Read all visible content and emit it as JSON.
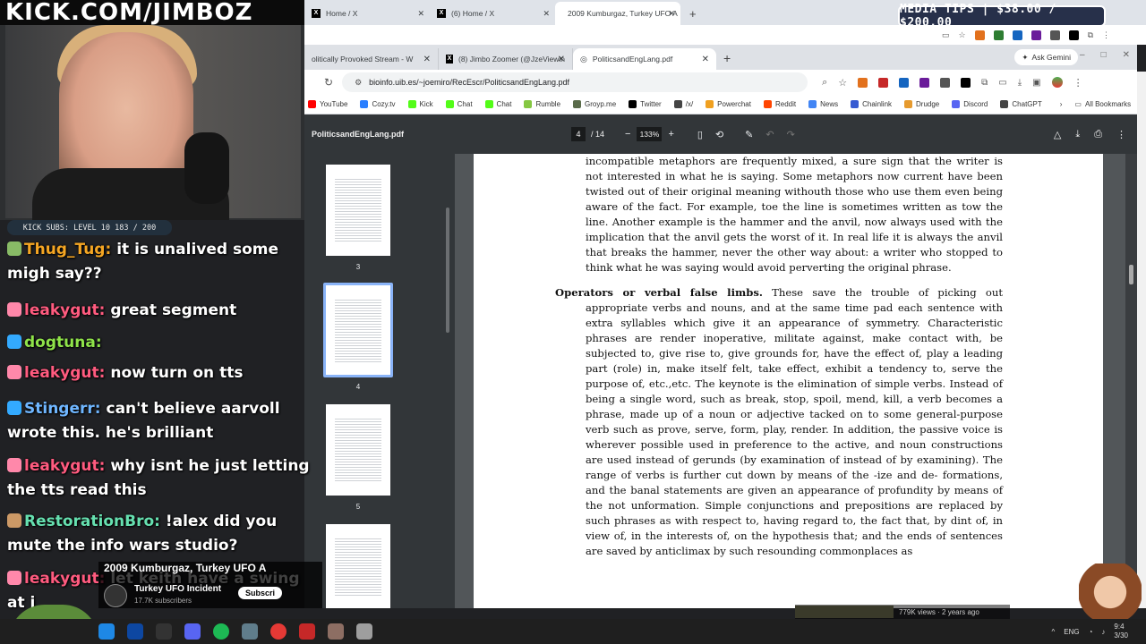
{
  "stream": {
    "banner": "KICK.COM/JIMBOZ",
    "subs_bar": "KICK SUBS: LEVEL 10 183 / 200",
    "media_tips": "MEDIA TIPS | $38.00 / $200.00"
  },
  "outer_browser": {
    "tabs": [
      {
        "label": "Home / X"
      },
      {
        "label": "(6) Home / X"
      },
      {
        "label": "2009 Kumburgaz, Turkey UFO A",
        "active": true
      }
    ]
  },
  "browser": {
    "tabs": [
      {
        "label": "olitically Provoked Stream - W"
      },
      {
        "label": "(8) Jimbo Zoomer (@JzeViewin"
      },
      {
        "label": "PoliticsandEngLang.pdf",
        "active": true
      }
    ],
    "gemini_label": "Ask Gemini",
    "url": "bioinfo.uib.es/~joemiro/RecEscr/PoliticsandEngLang.pdf",
    "bookmarks": [
      {
        "label": "YouTube",
        "color": "#ff0000"
      },
      {
        "label": "Cozy.tv",
        "color": "#2a7fff"
      },
      {
        "label": "Kick",
        "color": "#53fc18"
      },
      {
        "label": "Chat",
        "color": "#53fc18"
      },
      {
        "label": "Chat",
        "color": "#53fc18"
      },
      {
        "label": "Rumble",
        "color": "#85c742"
      },
      {
        "label": "Groyp.me",
        "color": "#5a6b4a"
      },
      {
        "label": "Twitter",
        "color": "#000000"
      },
      {
        "label": "/x/",
        "color": "#444444"
      },
      {
        "label": "Powerchat",
        "color": "#f0a020"
      },
      {
        "label": "Reddit",
        "color": "#ff4500"
      },
      {
        "label": "News",
        "color": "#4285f4"
      },
      {
        "label": "Chainlink",
        "color": "#375bd2"
      },
      {
        "label": "Drudge",
        "color": "#e69a2e"
      },
      {
        "label": "Discord",
        "color": "#5865f2"
      },
      {
        "label": "ChatGPT",
        "color": "#444444"
      }
    ],
    "all_bookmarks": "All Bookmarks"
  },
  "pdf": {
    "title": "PoliticsandEngLang.pdf",
    "page": "4",
    "page_total": "/ 14",
    "zoom": "133%",
    "thumbs": [
      "3",
      "4",
      "5"
    ],
    "selected_page": "4",
    "para1": "incompatible metaphors are frequently mixed, a sure sign that the writer is not interested in what he is saying. Some metaphors now current have been twisted out of their original meaning withouth those who use them even being aware of the fact. For example, toe the line is sometimes written as tow the line. Another example is the hammer and the anvil, now always used with the implication that the anvil gets the worst of it. In real life it is always the anvil that breaks the hammer, never the other way about: a writer who stopped to think what he was saying would avoid perverting the original phrase.",
    "para2_heading": "Operators or verbal false limbs.",
    "para2": "These save the trouble of picking out appropriate verbs and nouns, and at the same time pad each sentence with extra syllables which give it an appearance of symmetry. Characteristic phrases are render inoperative, militate against, make contact with, be subjected to, give rise to, give grounds for, have the effect of, play a leading part (role) in, make itself felt, take effect, exhibit a tendency to, serve the purpose of, etc.,etc. The keynote is the elimination of simple verbs. Instead of being a single word, such as break, stop, spoil, mend, kill, a verb becomes a phrase, made up of a noun or adjective tacked on to some general-purpose verb such as prove, serve, form, play, render. In addition, the passive voice is wherever possible used in preference to the active, and noun constructions are used instead of gerunds (by examination of instead of by examining). The range of verbs is further cut down by means of the -ize and de- formations, and the banal statements are given an appearance of profundity by means of the not unformation. Simple conjunctions and prepositions are replaced by such phrases as with respect to, having regard to, the fact that, by dint of, in view of, in the interests of, on the hypothesis that; and the ends of sentences are saved by anticlimax by such resounding commonplaces as"
  },
  "chat": [
    {
      "user": "Thug_Tug",
      "color": "#f5a623",
      "text": "it is unalived some migh say??"
    },
    {
      "user": "leakygut",
      "color": "#ff5b7f",
      "text": "great segment"
    },
    {
      "user": "dogtuna",
      "color": "#8fe34a",
      "text": ""
    },
    {
      "user": "leakygut",
      "color": "#ff5b7f",
      "text": "now turn on tts"
    },
    {
      "user": "Stingerr",
      "color": "#6fb6ff",
      "text": "can't believe aarvoll wrote this. he's brilliant"
    },
    {
      "user": "leakygut",
      "color": "#ff5b7f",
      "text": "why isnt he just letting the tts read this"
    },
    {
      "user": "RestorationBro",
      "color": "#66e0b0",
      "text": "!alex did you mute the info wars studio?"
    },
    {
      "user": "leakygut",
      "color": "#ff5b7f",
      "text": "let keith have a swing at i"
    }
  ],
  "youtube": {
    "title": "2009 Kumburgaz, Turkey UFO A",
    "channel": "Turkey UFO Incident",
    "subscribers": "17.7K subscribers",
    "subscribe": "Subscri",
    "views": "779K views · 2 years ago"
  },
  "taskbar": {
    "lang": "ENG",
    "time": "9:4",
    "date": "3/30"
  }
}
